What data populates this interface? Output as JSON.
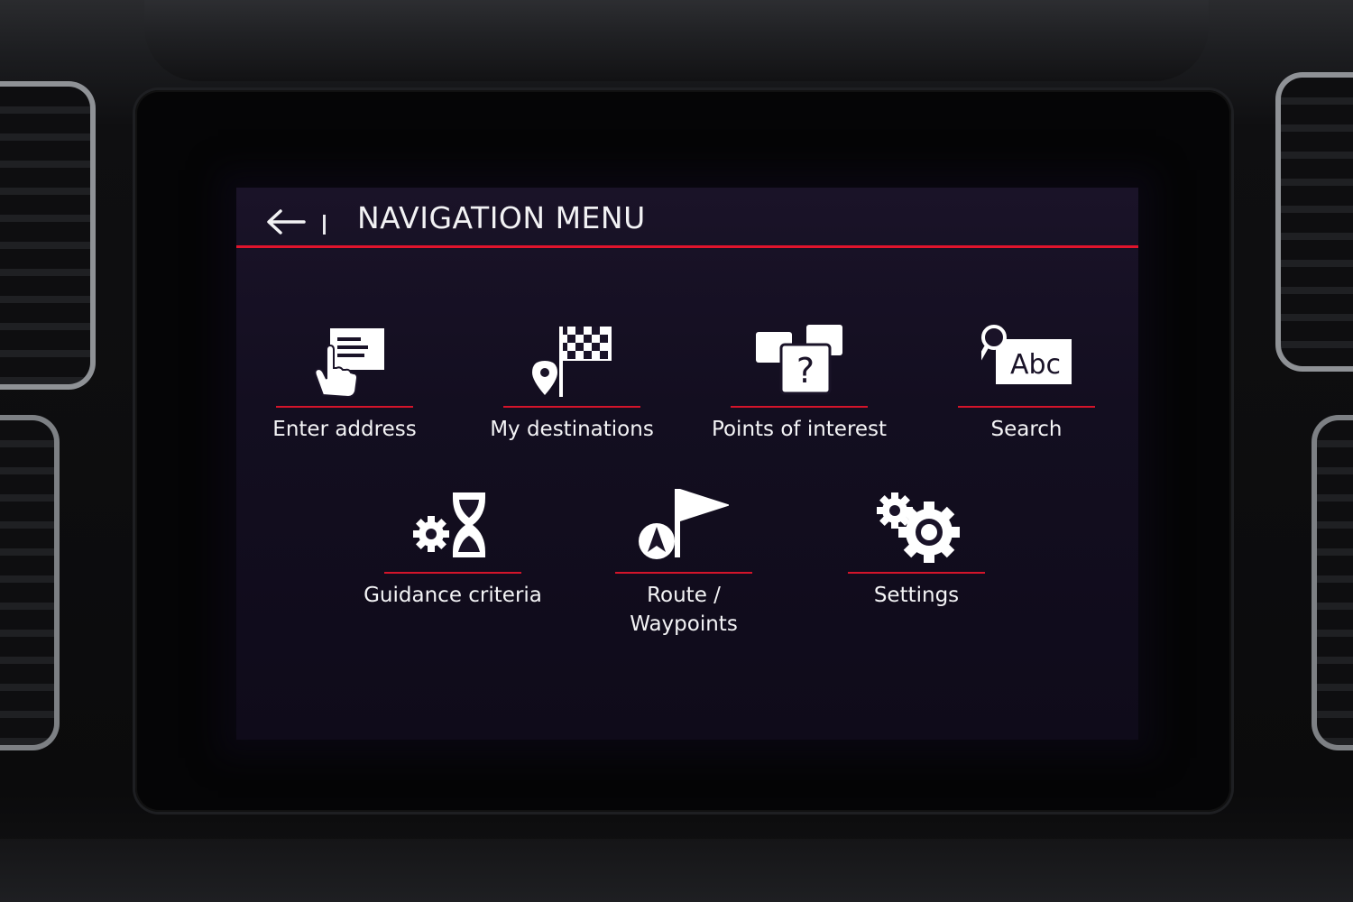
{
  "header": {
    "title": "NAVIGATION MENU",
    "back_icon": "arrow-left-icon"
  },
  "menu": {
    "row1": [
      {
        "label": "Enter address",
        "icon": "hand-envelope-icon"
      },
      {
        "label": "My destinations",
        "icon": "checkered-flag-pin-icon"
      },
      {
        "label": "Points of interest",
        "icon": "question-cards-icon"
      },
      {
        "label": "Search",
        "icon": "magnifier-abc-icon"
      }
    ],
    "row2": [
      {
        "label": "Guidance criteria",
        "icon": "gear-hourglass-icon"
      },
      {
        "label": "Route /",
        "label2": "Waypoints",
        "icon": "route-flag-icon"
      },
      {
        "label": "Settings",
        "icon": "gears-icon"
      }
    ],
    "search_icon_text": "Abc",
    "poi_icon_text": "?"
  },
  "colors": {
    "accent": "#e0142c",
    "screen_bg": "#140f22",
    "text": "#f2f2f4"
  }
}
